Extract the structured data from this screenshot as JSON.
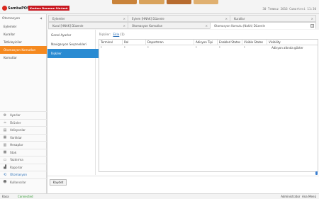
{
  "header": {
    "app_name": "SambaPOS",
    "trial_label": "Kısıtsız Deneme Sürümü",
    "datetime": "30 Temmuz 2016 Cumartesi 11:30",
    "photo_colors": [
      "#c9833a",
      "#d9a35c",
      "#b76b2f",
      "#e0b070"
    ]
  },
  "left_panel": {
    "title": "Otomasyon",
    "items": [
      {
        "label": "Eylemler",
        "active": false
      },
      {
        "label": "Kurallar",
        "active": false
      },
      {
        "label": "Tetikleyiciler",
        "active": false
      },
      {
        "label": "Otomasyon Komutları",
        "active": true
      },
      {
        "label": "Komutlar",
        "active": false
      }
    ]
  },
  "nav": {
    "items": [
      {
        "label": "Ayarlar",
        "icon": "gear-icon",
        "glyph": "⚙",
        "active": false
      },
      {
        "label": "Ürünler",
        "icon": "product-icon",
        "glyph": "☕",
        "active": false
      },
      {
        "label": "Adisyonlar",
        "icon": "ticket-icon",
        "glyph": "▤",
        "active": false
      },
      {
        "label": "Varlıklar",
        "icon": "entity-icon",
        "glyph": "▦",
        "active": false
      },
      {
        "label": "Hesaplar",
        "icon": "account-icon",
        "glyph": "▥",
        "active": false
      },
      {
        "label": "Stok",
        "icon": "inventory-icon",
        "glyph": "▩",
        "active": false
      },
      {
        "label": "Yazdırma",
        "icon": "print-icon",
        "glyph": "▭",
        "active": false
      },
      {
        "label": "Raporlar",
        "icon": "reports-icon",
        "glyph": "▟",
        "active": false
      },
      {
        "label": "Otomasyon",
        "icon": "automation-icon",
        "glyph": "⟲",
        "active": true
      },
      {
        "label": "Kullanıcılar",
        "icon": "users-icon",
        "glyph": "☻",
        "active": false
      }
    ]
  },
  "tabs": {
    "row1": [
      {
        "label": "Eylemler"
      },
      {
        "label": "Eylem [HNAK] Düzenle"
      },
      {
        "label": "Kurallar"
      }
    ],
    "row2": [
      {
        "label": "Kural [HNAK] Düzenle"
      },
      {
        "label": "Otomasyon Komutları"
      },
      {
        "label": "Otomasyon Komutu (Nakit) Düzenle"
      }
    ]
  },
  "editor": {
    "side_tabs": [
      "Genel Ayarlar",
      "Navigasyon Seçenekleri",
      "İlişkiler"
    ],
    "active_side_tab": "İlişkiler",
    "relations_label": "İlişkiler:",
    "add_link": "Ekle",
    "add_count": "(1)",
    "columns": [
      "Terminal",
      "Rol",
      "Departman",
      "Adisyon Tipi",
      "Enabled States",
      "Visible States",
      "Visibility"
    ],
    "rows": [
      {
        "terminal": "*",
        "role": "*",
        "department": "*",
        "ticket_type": "*",
        "enabled_states": "*",
        "visible_states": "*",
        "visibility": "Adisyon altında göster"
      }
    ],
    "save_label": "Kaydet"
  },
  "status": {
    "terminal": "Kasa",
    "connection": "Connected",
    "user": "Administrator",
    "menu": "Ana Menü"
  }
}
